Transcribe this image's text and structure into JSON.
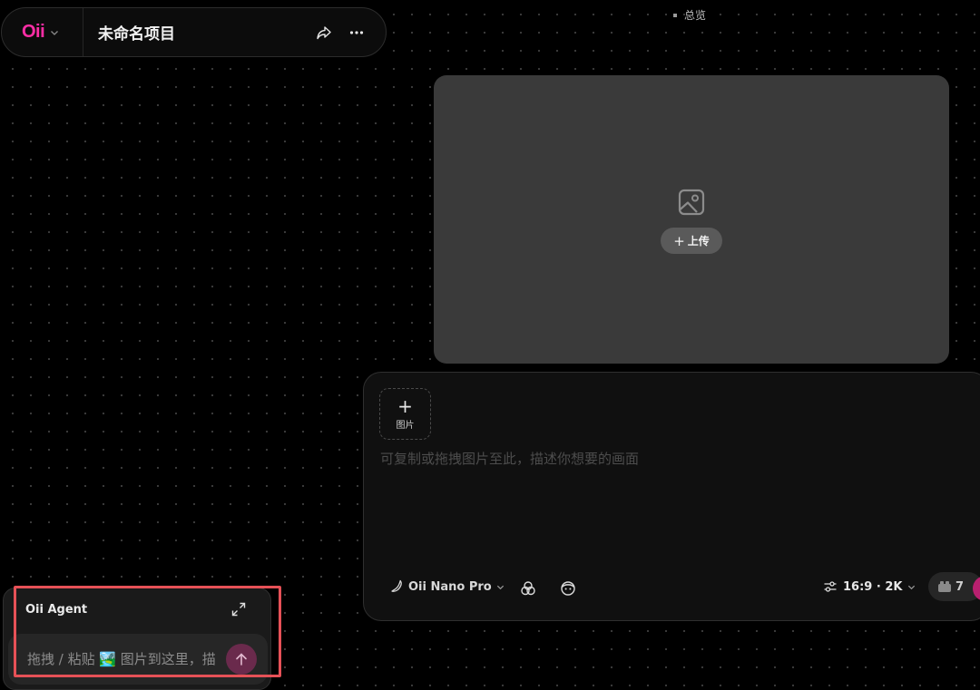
{
  "header": {
    "logo_text": "Oii",
    "project_title": "未命名项目",
    "icons": [
      "chevron-down-icon",
      "share-icon",
      "more-icon"
    ]
  },
  "overview": {
    "label": "总览"
  },
  "upload_card": {
    "icon": "image-icon",
    "upload_label": "上传",
    "upload_icon": "plus-icon"
  },
  "prompt_panel": {
    "add_image_label": "图片",
    "placeholder": "可复制或拖拽图片至此，描述你想要的画面",
    "model": "Oii Nano Pro",
    "ratio": "16:9 · 2K",
    "credits": "7",
    "icons": [
      "banana-icon",
      "style-mix-icon",
      "face-icon",
      "sliders-icon",
      "coins-icon"
    ]
  },
  "agent": {
    "title": "Oii Agent",
    "placeholder": "拖拽 / 粘贴 🏞️ 图片到这里，描述你想要的画面",
    "icons": [
      "expand-icon",
      "send-arrow-icon"
    ]
  },
  "colors": {
    "brand": "#ff2ea6",
    "send": "#b8206f",
    "highlight": "#e65157",
    "panel": "#101010",
    "card": "#3a3a3a"
  }
}
